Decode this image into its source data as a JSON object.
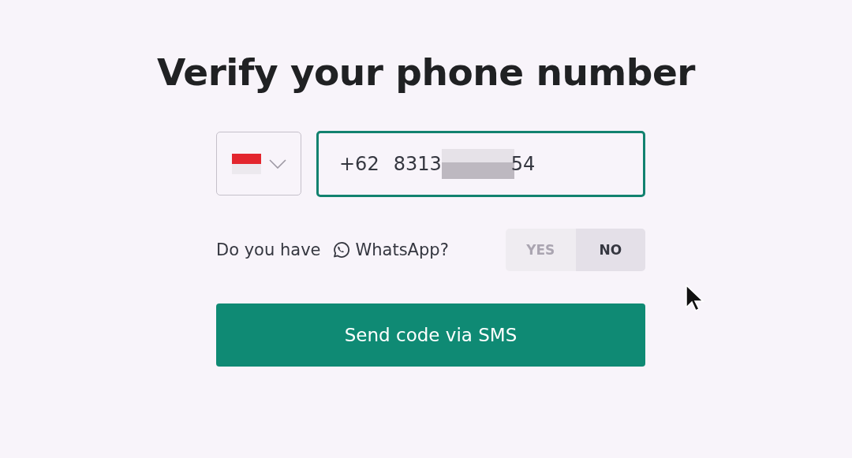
{
  "title": "Verify your phone number",
  "country_select": {
    "expanded": false
  },
  "phone": {
    "dial_code": "+62",
    "number_start": "8313",
    "number_end": "54"
  },
  "whatsapp": {
    "question_start": "Do you have",
    "question_end": "WhatsApp?",
    "options": [
      {
        "label": "YES",
        "selected": false
      },
      {
        "label": "NO",
        "selected": true
      }
    ]
  },
  "submit": {
    "label": "Send code via SMS"
  }
}
